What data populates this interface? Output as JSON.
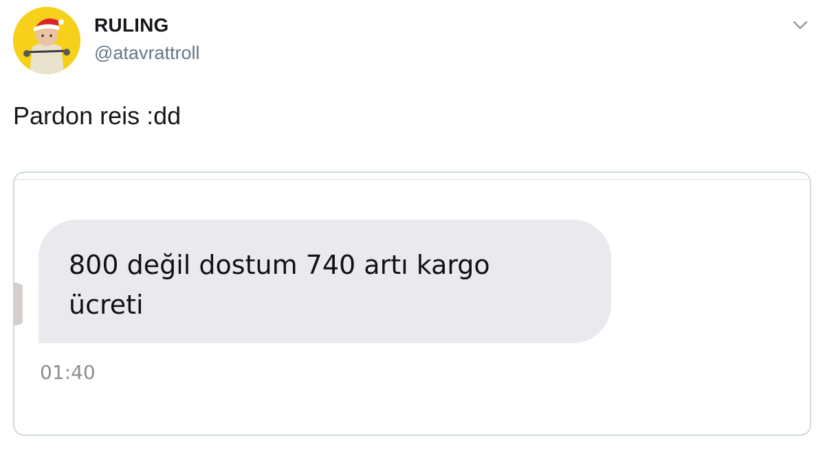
{
  "tweet": {
    "author": {
      "display_name": "RULING",
      "handle": "@atavrattroll",
      "avatar_icon": "profile-avatar",
      "avatar_bg": "#f6d01a"
    },
    "menu_icon": "chevron-down-icon",
    "text": "Pardon reis :dd"
  },
  "media": {
    "message": {
      "text": "800 değil dostum 740 artı kargo\nücreti",
      "timestamp": "01:40",
      "bubble_color": "#e9e9ee"
    }
  },
  "colors": {
    "text_primary": "#14171a",
    "text_secondary": "#657786",
    "border": "#cfd9de",
    "timestamp": "#8e8e93"
  }
}
